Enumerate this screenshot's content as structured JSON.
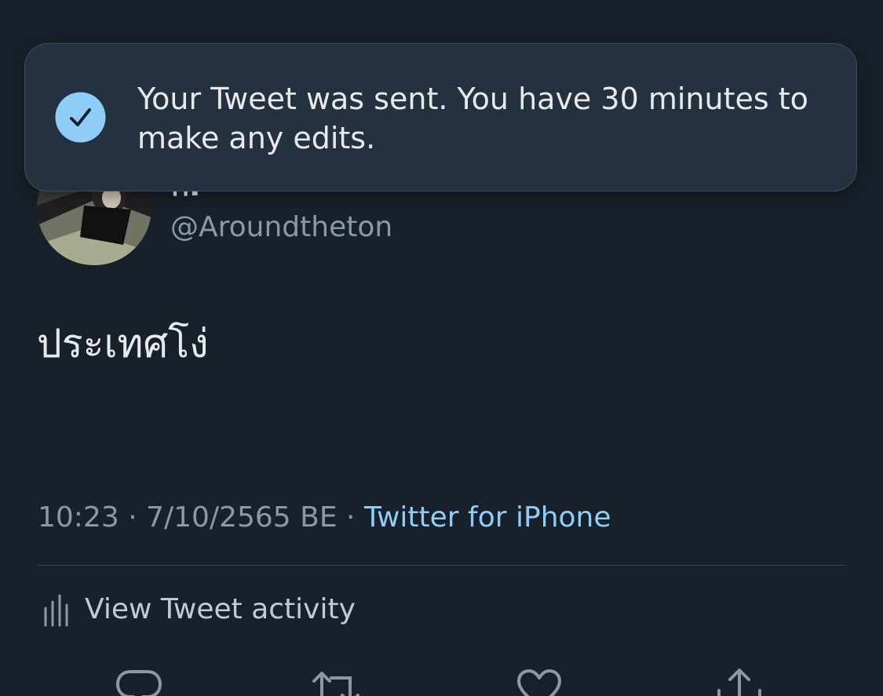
{
  "toast": {
    "message": "Your Tweet was sent. You have 30 minutes to make any edits.",
    "icon": "check-circle-icon",
    "accent": "#8ecdf8"
  },
  "tweet": {
    "display_name": "ก.",
    "handle": "@Aroundtheton",
    "text": "ประเทศโง่",
    "time": "10:23",
    "date": "7/10/2565 BE",
    "separator": "·",
    "source": "Twitter for iPhone"
  },
  "activity": {
    "label": "View Tweet activity",
    "icon": "bar-chart-icon"
  },
  "actions": [
    {
      "icon": "reply-icon"
    },
    {
      "icon": "retweet-icon"
    },
    {
      "icon": "like-icon"
    },
    {
      "icon": "share-icon"
    }
  ],
  "colors": {
    "background": "#182029",
    "text_primary": "#e7e9ea",
    "text_secondary": "#8b98a5",
    "link": "#8ecdf8",
    "toast_background": "#24313f"
  }
}
